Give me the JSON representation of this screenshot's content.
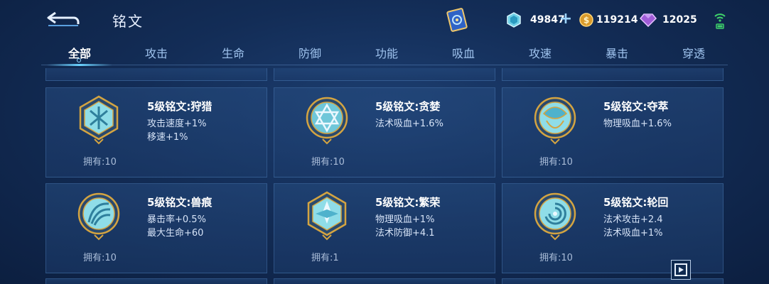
{
  "header": {
    "title": "铭文"
  },
  "currency": {
    "crystal": "49847",
    "coin": "119214",
    "gem": "12025"
  },
  "tabs": [
    "全部",
    "攻击",
    "生命",
    "防御",
    "功能",
    "吸血",
    "攻速",
    "暴击",
    "穿透"
  ],
  "active_tab": "全部",
  "runes": [
    {
      "name": "5级铭文:狩猎",
      "attrs": [
        "攻击速度+1%",
        "移速+1%"
      ],
      "owned": "拥有:10"
    },
    {
      "name": "5级铭文:贪婪",
      "attrs": [
        "法术吸血+1.6%"
      ],
      "owned": "拥有:10"
    },
    {
      "name": "5级铭文:夺萃",
      "attrs": [
        "物理吸血+1.6%"
      ],
      "owned": "拥有:10"
    },
    {
      "name": "5级铭文:兽痕",
      "attrs": [
        "暴击率+0.5%",
        "最大生命+60"
      ],
      "owned": "拥有:10"
    },
    {
      "name": "5级铭文:繁荣",
      "attrs": [
        "物理吸血+1%",
        "法术防御+4.1"
      ],
      "owned": "拥有:1"
    },
    {
      "name": "5级铭文:轮回",
      "attrs": [
        "法术攻击+2.4",
        "法术吸血+1%"
      ],
      "owned": "拥有:10"
    }
  ],
  "icons": {
    "back": "back-arrow-icon",
    "book": "rune-book-icon",
    "crystal": "crystal-icon",
    "coin": "gold-coin-icon",
    "gem": "diamond-icon",
    "signal": "wifi-signal-icon",
    "corner": "play-panel-icon"
  },
  "colors": {
    "accent": "#6ad2ff",
    "gold": "#d4a441",
    "emblem_teal": "#7fd9e6"
  }
}
